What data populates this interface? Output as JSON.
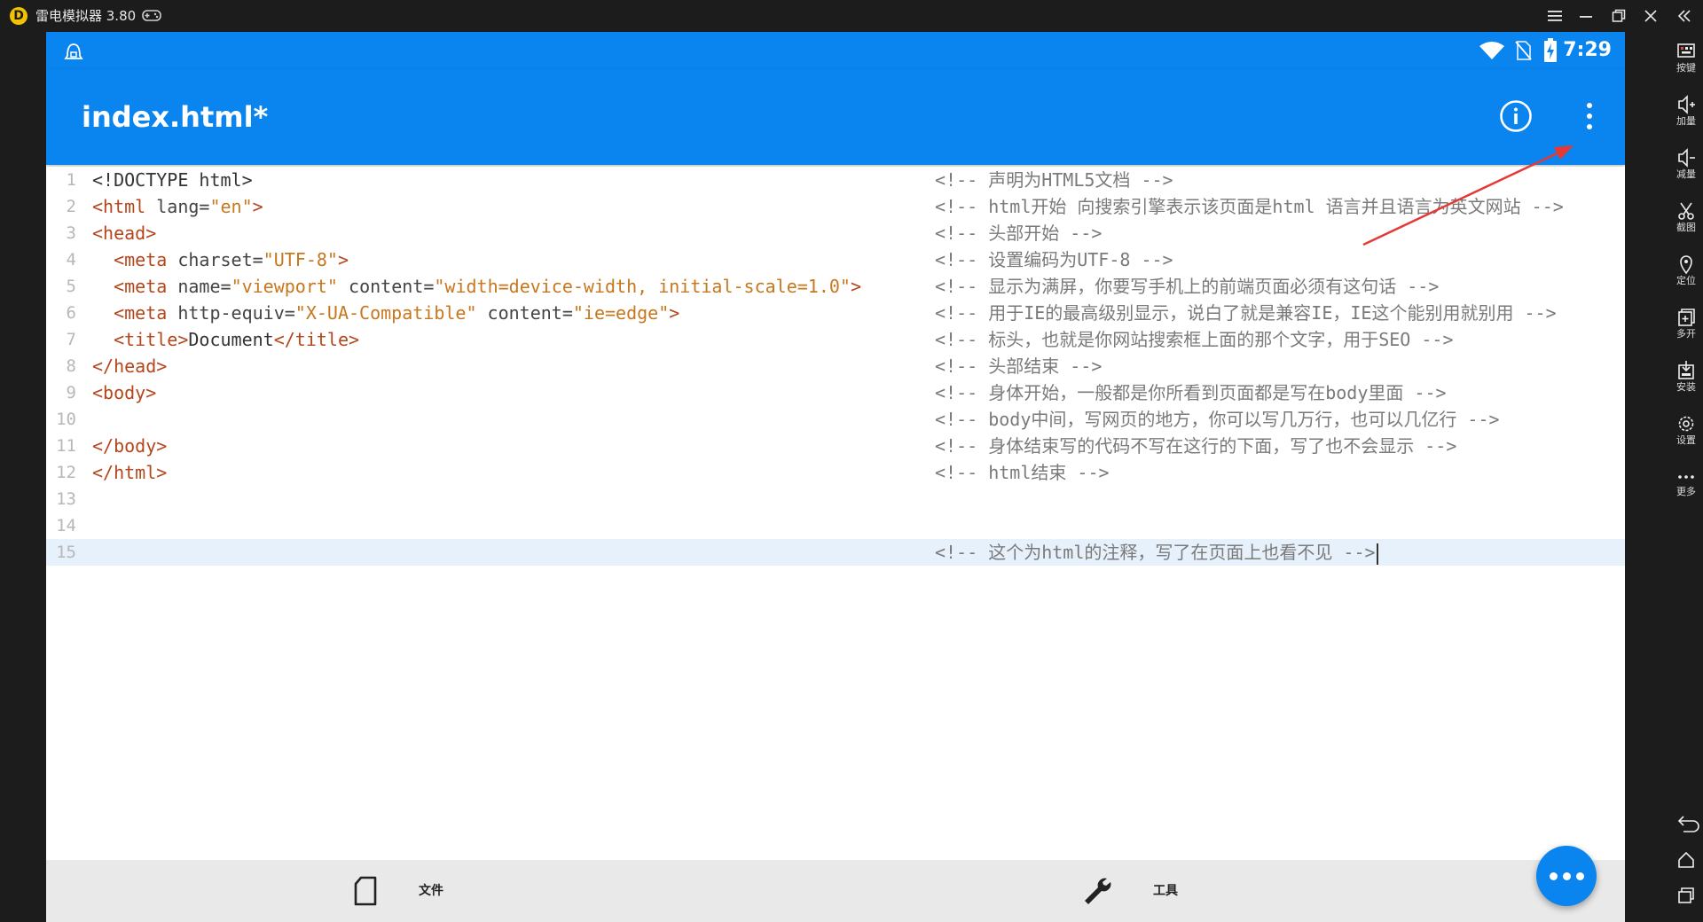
{
  "emulator": {
    "title": "雷电模拟器 3.80",
    "logo": "D",
    "window_buttons": [
      "menu-icon",
      "minimize-icon",
      "restore-icon",
      "close-icon",
      "collapse-sidebar-icon"
    ]
  },
  "sidebar": {
    "items": [
      {
        "label": "按键",
        "icon": "keyboard-icon"
      },
      {
        "label": "加量",
        "icon": "volume-up-icon"
      },
      {
        "label": "减量",
        "icon": "volume-down-icon"
      },
      {
        "label": "截图",
        "icon": "scissors-icon"
      },
      {
        "label": "定位",
        "icon": "location-icon"
      },
      {
        "label": "多开",
        "icon": "multi-instance-icon"
      },
      {
        "label": "安装",
        "icon": "apk-install-icon"
      },
      {
        "label": "设置",
        "icon": "settings-icon"
      },
      {
        "label": "更多",
        "icon": "more-icon"
      }
    ],
    "nav": [
      "back-icon",
      "home-icon",
      "recent-apps-icon"
    ]
  },
  "status_bar": {
    "time": "7:29",
    "icons": [
      "wifi-icon",
      "no-sim-icon",
      "battery-charging-icon"
    ]
  },
  "app_bar": {
    "title": "index.html*"
  },
  "editor": {
    "lines": [
      {
        "n": "1",
        "code": [
          [
            "txt",
            "<!DOCTYPE html>"
          ]
        ],
        "comment": "<!-- 声明为HTML5文档 -->"
      },
      {
        "n": "2",
        "code": [
          [
            "tag",
            "<html "
          ],
          [
            "attr",
            "lang="
          ],
          [
            "val",
            "\"en\""
          ],
          [
            "tag",
            ">"
          ]
        ],
        "comment": "<!-- html开始 向搜索引擎表示该页面是html 语言并且语言为英文网站 -->"
      },
      {
        "n": "3",
        "code": [
          [
            "tag",
            "<head>"
          ]
        ],
        "comment": "<!-- 头部开始 -->"
      },
      {
        "n": "4",
        "code": [
          [
            "txt",
            "  "
          ],
          [
            "tag",
            "<meta "
          ],
          [
            "attr",
            "charset="
          ],
          [
            "val",
            "\"UTF-8\""
          ],
          [
            "tag",
            ">"
          ]
        ],
        "comment": "<!-- 设置编码为UTF-8 -->"
      },
      {
        "n": "5",
        "code": [
          [
            "txt",
            "  "
          ],
          [
            "tag",
            "<meta "
          ],
          [
            "attr",
            "name="
          ],
          [
            "val",
            "\"viewport\""
          ],
          [
            "attr",
            " content="
          ],
          [
            "val",
            "\"width=device-width, initial-scale=1.0\""
          ],
          [
            "tag",
            ">"
          ]
        ],
        "comment": "<!-- 显示为满屏，你要写手机上的前端页面必须有这句话 -->"
      },
      {
        "n": "6",
        "code": [
          [
            "txt",
            "  "
          ],
          [
            "tag",
            "<meta "
          ],
          [
            "attr",
            "http-equiv="
          ],
          [
            "val",
            "\"X-UA-Compatible\""
          ],
          [
            "attr",
            " content="
          ],
          [
            "val",
            "\"ie=edge\""
          ],
          [
            "tag",
            ">"
          ]
        ],
        "comment": "<!-- 用于IE的最高级别显示，说白了就是兼容IE，IE这个能别用就别用 -->"
      },
      {
        "n": "7",
        "code": [
          [
            "txt",
            "  "
          ],
          [
            "tag",
            "<title>"
          ],
          [
            "txt",
            "Document"
          ],
          [
            "tag",
            "</title>"
          ]
        ],
        "comment": "<!-- 标头，也就是你网站搜索框上面的那个文字，用于SEO -->"
      },
      {
        "n": "8",
        "code": [
          [
            "tag",
            "</head>"
          ]
        ],
        "comment": "<!-- 头部结束 -->"
      },
      {
        "n": "9",
        "code": [
          [
            "tag",
            "<body>"
          ]
        ],
        "comment": "<!-- 身体开始，一般都是你所看到页面都是写在body里面 -->"
      },
      {
        "n": "10",
        "code": [],
        "comment": "<!-- body中间，写网页的地方，你可以写几万行，也可以几亿行 -->"
      },
      {
        "n": "11",
        "code": [
          [
            "tag",
            "</body>"
          ]
        ],
        "comment": "<!-- 身体结束写的代码不写在这行的下面，写了也不会显示 -->"
      },
      {
        "n": "12",
        "code": [
          [
            "tag",
            "</html>"
          ]
        ],
        "comment": "<!-- html结束 -->"
      },
      {
        "n": "13",
        "code": [],
        "comment": ""
      },
      {
        "n": "14",
        "code": [],
        "comment": ""
      },
      {
        "n": "15",
        "code": [],
        "comment": "<!-- 这个为html的注释，写了在页面上也看不见 -->",
        "current": true
      }
    ]
  },
  "bottom_bar": {
    "file_label": "文件",
    "tools_label": "工具"
  },
  "colors": {
    "accent": "#0a84ee",
    "tag": "#b5451b",
    "value": "#c7771d",
    "comment": "#7a7a7a",
    "annotation_arrow": "#e53935"
  }
}
